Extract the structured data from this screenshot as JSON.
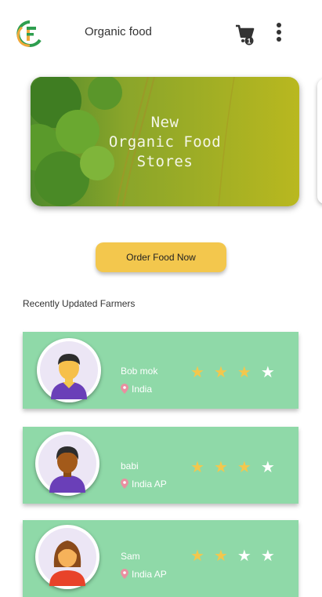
{
  "header": {
    "title": "Organic food",
    "cart_count": "1",
    "logo_icon": "organic-food-logo",
    "cart_icon": "cart-icon",
    "menu_icon": "more-vertical-icon"
  },
  "banner": {
    "text": "New\nOrganic Food\nStores"
  },
  "order_button": {
    "label": "Order Food Now"
  },
  "section": {
    "title": "Recently Updated Farmers"
  },
  "farmers": [
    {
      "name": "Bob mok",
      "location": "India",
      "rating": 3,
      "max_rating": 4
    },
    {
      "name": "babi",
      "location": "India AP",
      "rating": 3,
      "max_rating": 4
    },
    {
      "name": "Sam",
      "location": "India AP",
      "rating": 2,
      "max_rating": 4
    }
  ],
  "colors": {
    "accent": "#f3c74d",
    "card": "#8fd9a8",
    "logo_green": "#2e9e4f",
    "logo_orange": "#f0a93a"
  }
}
